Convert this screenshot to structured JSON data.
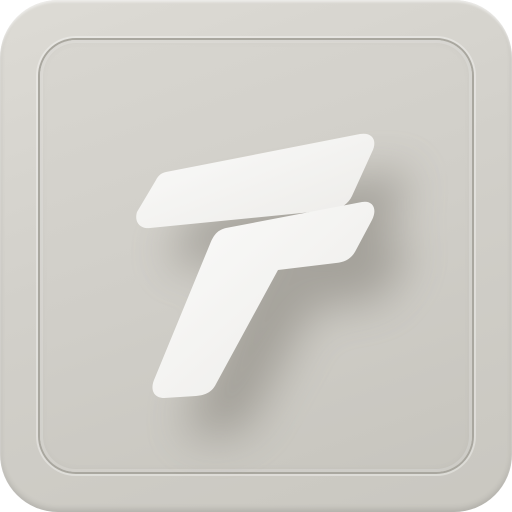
{
  "app_icon": {
    "icon": "stylized-f-icon",
    "colors": {
      "outer_frame": "#d4d2cc",
      "inner_face": "#d0cec8",
      "face_border": "#a9a79f",
      "glyph": "#f5f5f3",
      "glyph_shadow": "#6f6c63"
    }
  }
}
